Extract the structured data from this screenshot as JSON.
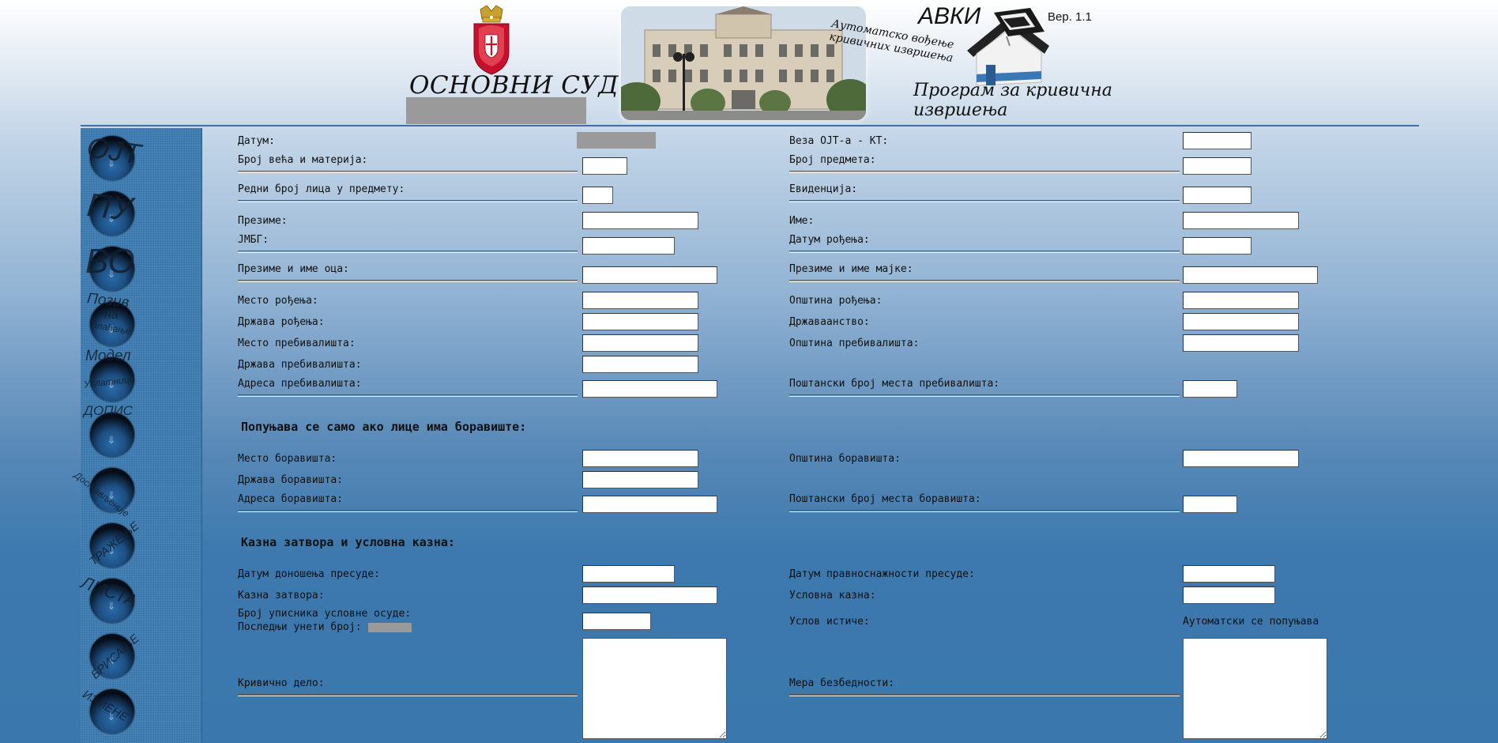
{
  "header": {
    "court_title": "ОСНОВНИ СУД",
    "app_name": "АВКИ",
    "version": "Вер. 1.1",
    "subtitle_line1": "Аутоматско вођење",
    "subtitle_line2": "кривичних извршења",
    "program_line1": "Програм за кривична",
    "program_line2": "извршења"
  },
  "sidebar": {
    "items": [
      {
        "label": "ОЈТ",
        "icon": "ojt-ball-icon"
      },
      {
        "label": "ПУ",
        "icon": "pu-ball-icon"
      },
      {
        "label": "ВО",
        "icon": "vo-ball-icon"
      },
      {
        "label": "Позив",
        "sub1": "на",
        "sub2": "плаћање",
        "icon": "poziv-ball-icon"
      },
      {
        "label": "Модел",
        "sub1": "Уплатнице",
        "icon": "model-ball-icon"
      },
      {
        "label": "ДОПИС",
        "icon": "dopis-ball-icon"
      },
      {
        "label": "Достављеније",
        "icon": "dostava-ball-icon"
      },
      {
        "label": "ТРАЖЕЊЕ",
        "icon": "trazenje-ball-icon"
      },
      {
        "label": "ЛИСТА",
        "icon": "lista-ball-icon"
      },
      {
        "label": "БРИСАЊЕ",
        "icon": "brisanje-ball-icon"
      },
      {
        "label": "ИЗМЕНЕ",
        "icon": "izmene-ball-icon"
      }
    ]
  },
  "form": {
    "left": {
      "datum": "Датум:",
      "broj_veca": "Број већа и материја:",
      "redni_broj": "Редни број лица у предмету:",
      "prezime": "Презиме:",
      "jmbg": "ЈМБГ:",
      "prezime_oca": "Презиме и име оца:",
      "mesto_rodjenja": "Место рођења:",
      "drzava_rodjenja": "Држава рођења:",
      "mesto_preb": "Место пребивалишта:",
      "drzava_preb": "Држава пребивалишта:",
      "adresa_preb": "Адреса пребивалишта:",
      "mesto_borav": "Место боравишта:",
      "drzava_borav": "Држава боравишта:",
      "adresa_borav": "Адреса боравишта:",
      "datum_presude": "Датум доношења пресуде:",
      "kazna_zatvora": "Казна затвора:",
      "broj_upisnika": "Број уписника условне осуде:",
      "poslednji_broj": "Последњи унети број:",
      "krivicno_delo": "Кривично дело:"
    },
    "right": {
      "veza": "Веза ОЈТ-а - КТ:",
      "broj_predmeta": "Број предмета:",
      "evidencija": "Евиденција:",
      "ime": "Име:",
      "datum_rodjenja": "Датум рођења:",
      "prezime_majke": "Презиме и име мајке:",
      "opstina_rodjenja": "Општина рођења:",
      "drzavljanstvo": "Државаанство:",
      "opstina_preb": "Општина пребивалишта:",
      "postanski_preb": "Поштански број места пребивалишта:",
      "opstina_borav": "Општина боравишта:",
      "postanski_borav": "Поштански број места боравишта:",
      "datum_pravosnaznosti": "Датум правноснажности пресуде:",
      "uslovna_kazna": "Условна казна:",
      "uslov_istice": "Услов истиче:",
      "automatski": "Аутоматски се попуњава",
      "mera_bezbednosti": "Мера безбедности:"
    },
    "section_boraviste": "Попуњава се само ако лице има боравиште:",
    "section_kazna": "Казна затвора и условна казна:"
  }
}
